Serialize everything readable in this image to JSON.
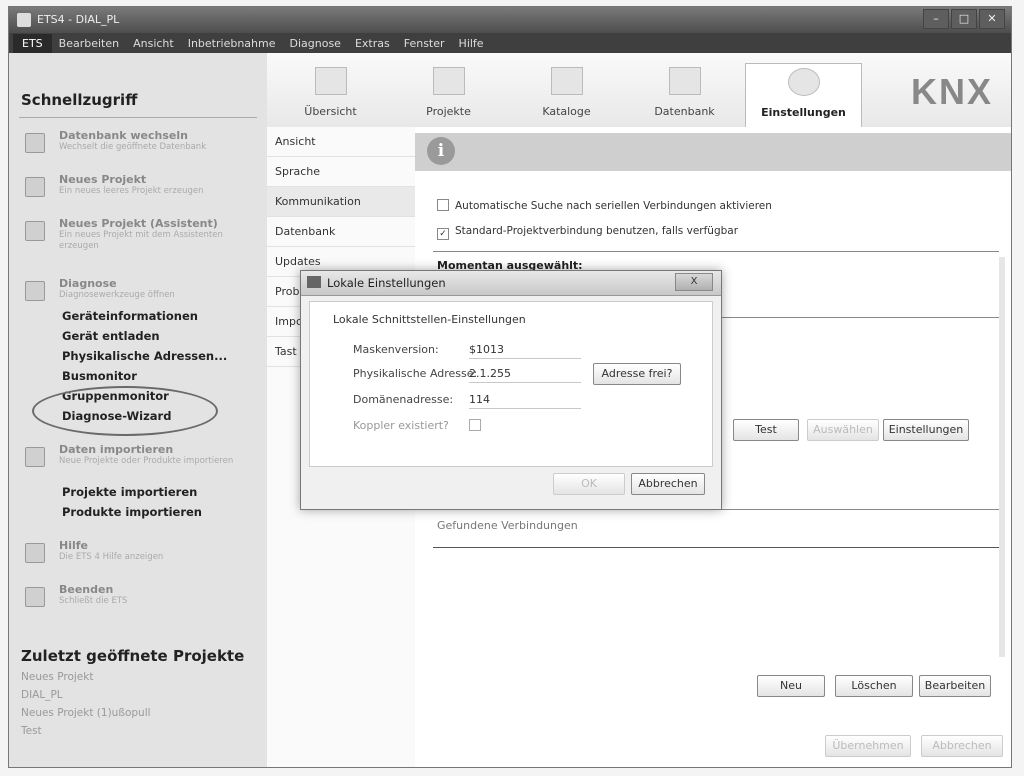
{
  "window": {
    "title": "ETS4 - DIAL_PL"
  },
  "menubar": [
    "ETS",
    "Bearbeiten",
    "Ansicht",
    "Inbetriebnahme",
    "Diagnose",
    "Extras",
    "Fenster",
    "Hilfe"
  ],
  "sidebar": {
    "title": "Schnellzugriff",
    "actions": [
      {
        "title": "Datenbank wechseln",
        "desc": "Wechselt die geöffnete Datenbank"
      },
      {
        "title": "Neues Projekt",
        "desc": "Ein neues leeres Projekt erzeugen"
      },
      {
        "title": "Neues Projekt (Assistent)",
        "desc": "Ein neues Projekt mit dem Assistenten erzeugen"
      },
      {
        "title": "Diagnose",
        "desc": "Diagnosewerkzeuge öffnen"
      },
      {
        "title": "Daten importieren",
        "desc": "Neue Projekte oder Produkte importieren"
      },
      {
        "title": "Hilfe",
        "desc": "Die ETS 4 Hilfe anzeigen"
      },
      {
        "title": "Beenden",
        "desc": "Schließt die ETS"
      }
    ],
    "diagnose_items": [
      "Geräteinformationen",
      "Gerät entladen",
      "Physikalische Adressen...",
      "Busmonitor",
      "Gruppenmonitor",
      "Diagnose-Wizard"
    ],
    "import_items": [
      "Projekte importieren",
      "Produkte importieren"
    ],
    "recent_title": "Zuletzt geöffnete Projekte",
    "recent": [
      "Neues Projekt",
      "DIAL_PL",
      "Neues Projekt (1)ußopull",
      "Test"
    ]
  },
  "toolbar": {
    "tabs": [
      "Übersicht",
      "Projekte",
      "Kataloge",
      "Datenbank",
      "Einstellungen"
    ],
    "logo": "KNX"
  },
  "leftnav": [
    "Ansicht",
    "Sprache",
    "Kommunikation",
    "Datenbank",
    "Updates",
    "Prob",
    "Impo",
    "Tast"
  ],
  "content": {
    "checkbox1": "Automatische Suche nach seriellen Verbindungen aktivieren",
    "checkbox2": "Standard-Projektverbindung benutzen, falls verfügbar",
    "checkbox2_mark": "✓",
    "selected_label": "Momentan ausgewählt:",
    "found_label": "Gefundene Verbindungen",
    "btn_test": "Test",
    "btn_auswaehlen": "Auswählen",
    "btn_einstellungen": "Einstellungen",
    "btn_neu": "Neu",
    "btn_loeschen": "Löschen",
    "btn_bearbeiten": "Bearbeiten",
    "btn_uebernehmen": "Übernehmen",
    "btn_abbrechen": "Abbrechen"
  },
  "dialog": {
    "title": "Lokale Einstellungen",
    "close": "X",
    "group": "Lokale Schnittstellen-Einstellungen",
    "fields": [
      {
        "label": "Maskenversion:",
        "value": "$1013"
      },
      {
        "label": "Physikalische Adresse:",
        "value": "2.1.255"
      },
      {
        "label": "Domänenadresse:",
        "value": "114"
      },
      {
        "label": "Koppler existiert?",
        "value": ""
      }
    ],
    "btn_adresse_frei": "Adresse frei?",
    "btn_ok": "OK",
    "btn_abbrechen": "Abbrechen"
  }
}
